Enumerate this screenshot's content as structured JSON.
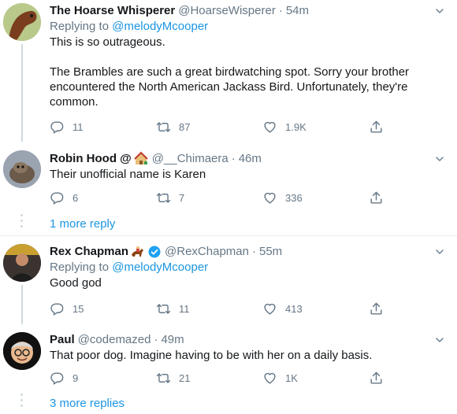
{
  "tweets": [
    {
      "name": "The Hoarse Whisperer",
      "handle": "@HoarseWisperer",
      "time": "54m",
      "replying_label": "Replying to",
      "replying_to": "@melodyMcooper",
      "text": "This is so outrageous.\n\nThe Brambles are such a great birdwatching spot. Sorry your brother encountered the North American Jackass Bird. Unfortunately, they're common.",
      "replies": "11",
      "retweets": "87",
      "likes": "1.9K"
    },
    {
      "name": "Robin Hood @",
      "handle": "@__Chimaera",
      "time": "46m",
      "text": "Their unofficial name is Karen",
      "replies": "6",
      "retweets": "7",
      "likes": "336"
    },
    {
      "name": "Rex Chapman",
      "handle": "@RexChapman",
      "time": "55m",
      "replying_label": "Replying to",
      "replying_to": "@melodyMcooper",
      "text": "Good god",
      "replies": "15",
      "retweets": "11",
      "likes": "413"
    },
    {
      "name": "Paul",
      "handle": "@codemazed",
      "time": "49m",
      "text": "That poor dog. Imagine having to be with her on a daily basis.",
      "replies": "9",
      "retweets": "21",
      "likes": "1K"
    }
  ],
  "more_replies": [
    "1 more reply",
    "3 more replies"
  ],
  "separator": "·",
  "colors": {
    "link": "#1b95e0",
    "muted": "#657786",
    "text": "#14171a",
    "divider": "#e6ecf0"
  },
  "icons": [
    "reply-icon",
    "retweet-icon",
    "like-icon",
    "share-icon",
    "chevron-down-icon",
    "verified-badge-icon",
    "house-emoji-icon",
    "horse-racing-emoji-icon"
  ]
}
